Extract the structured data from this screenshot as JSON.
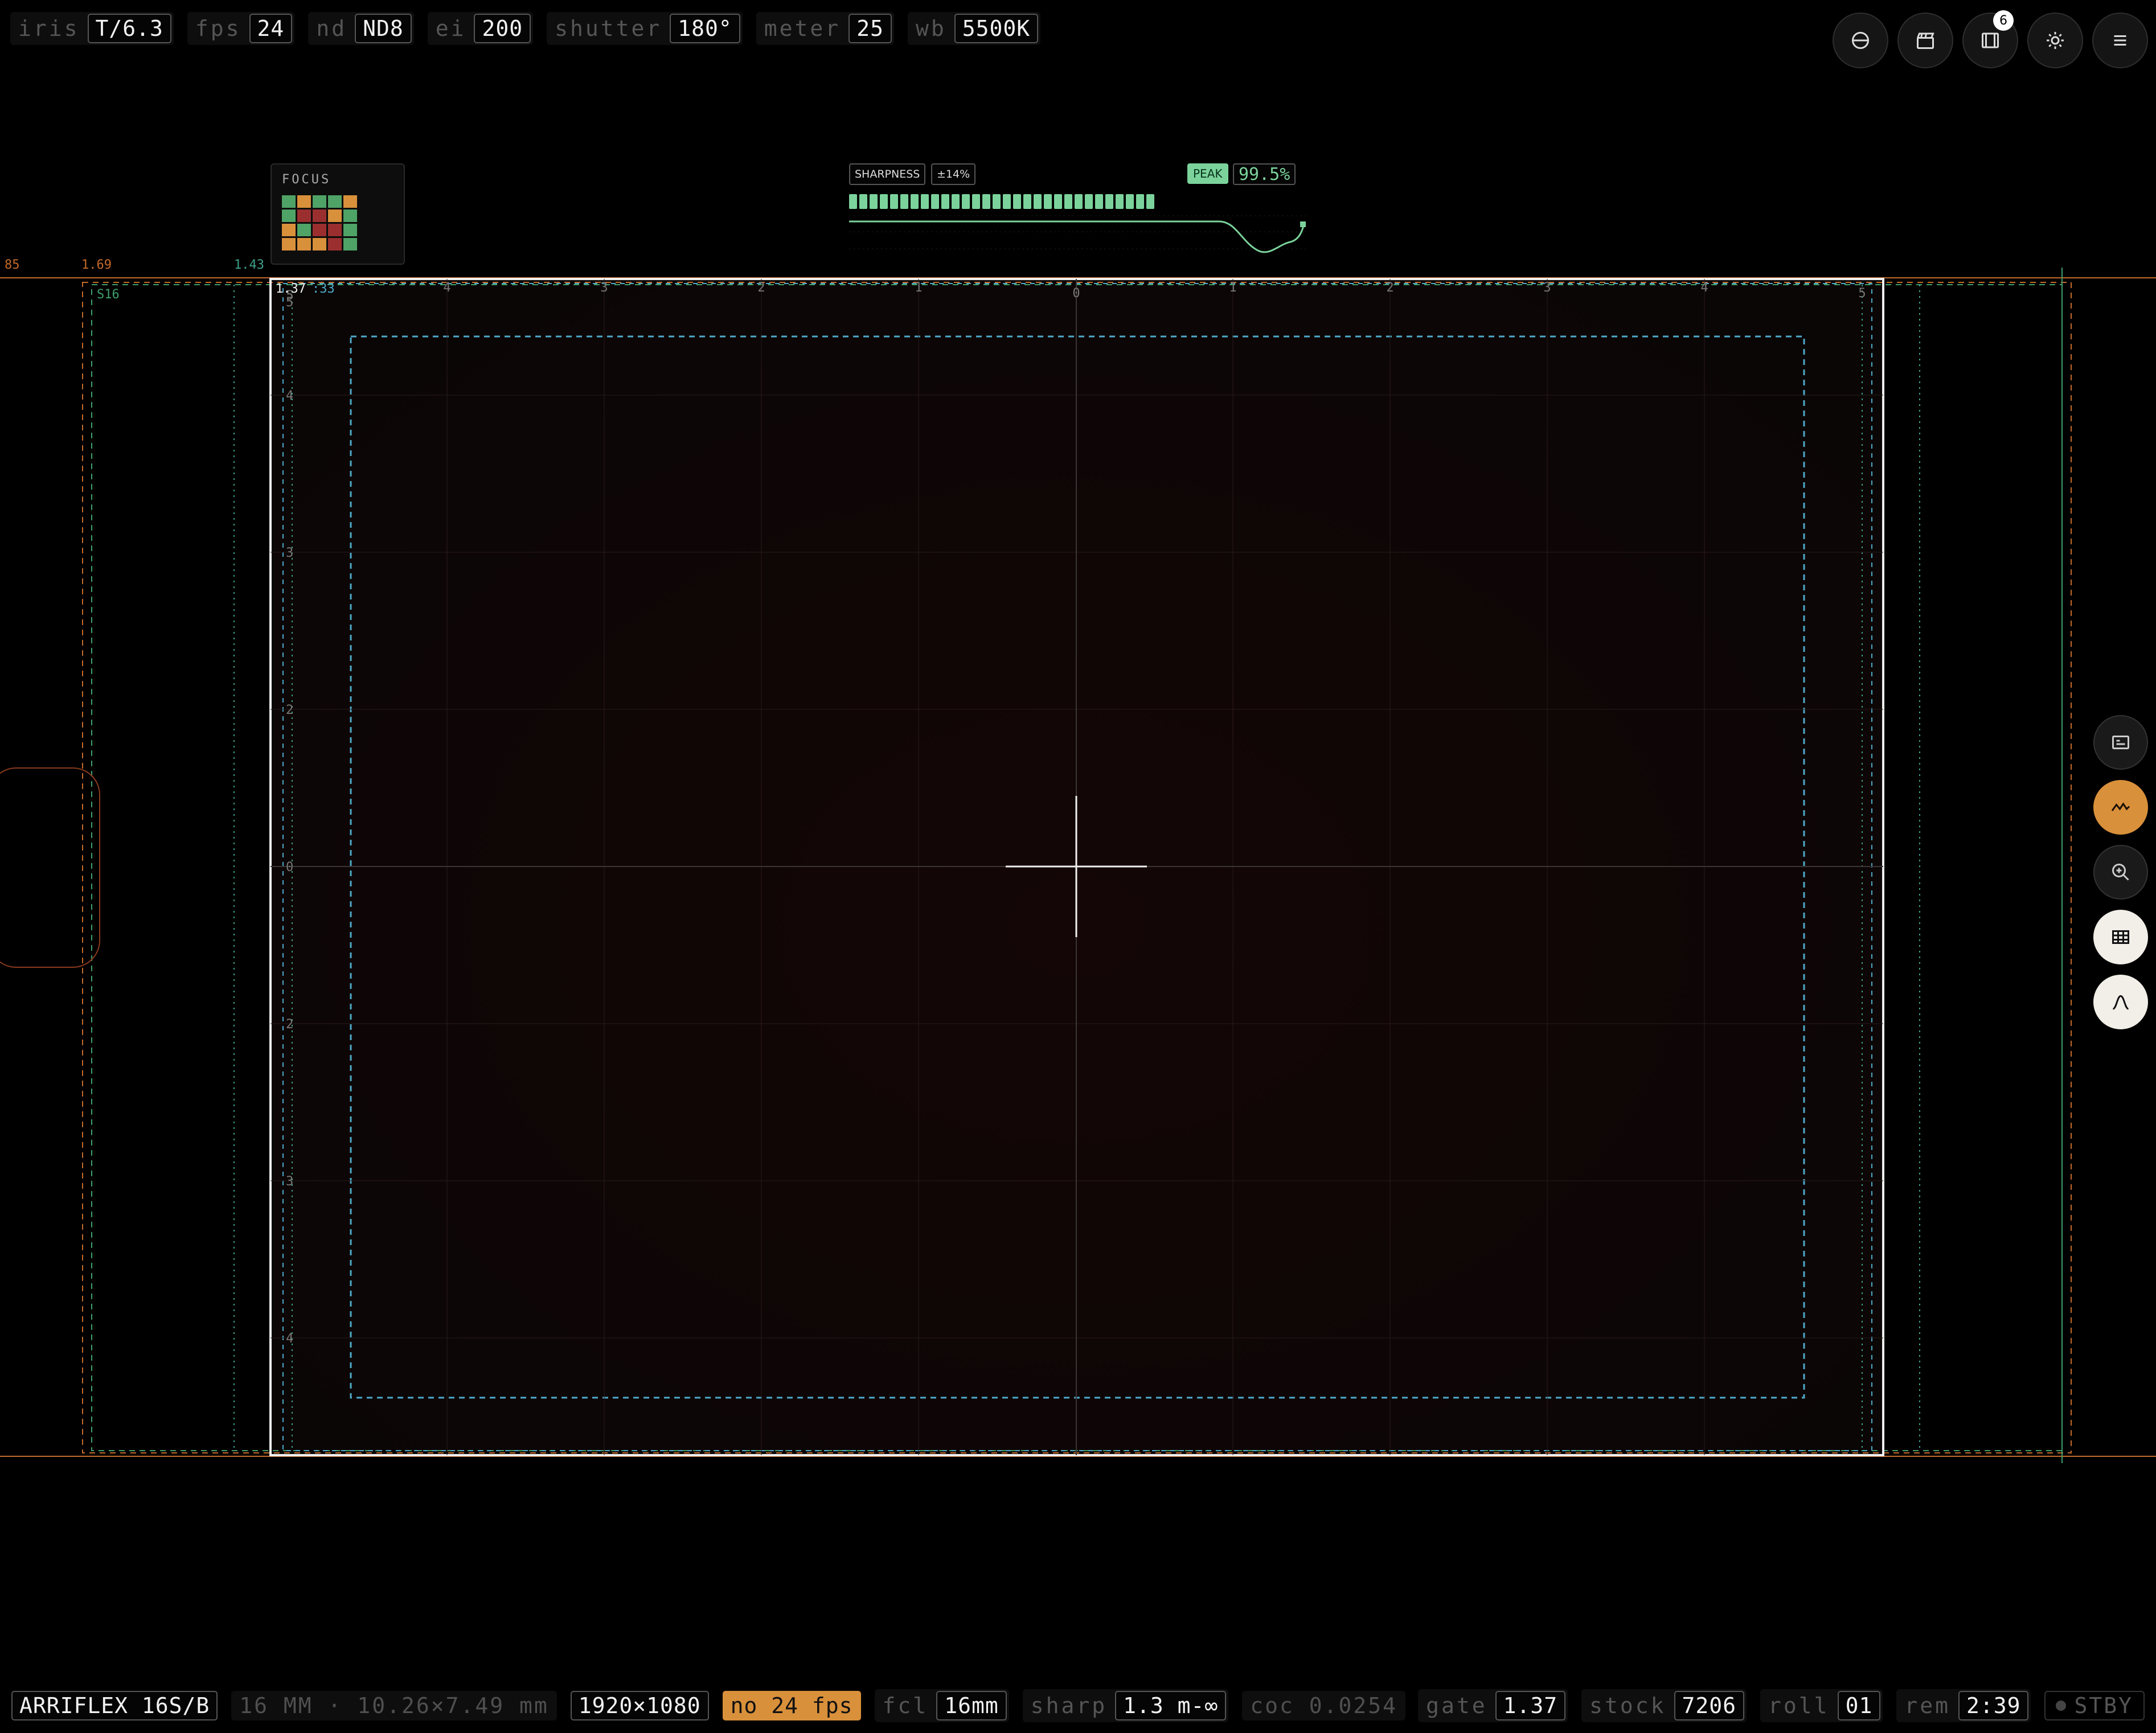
{
  "top_params": [
    {
      "label": "iris",
      "value": "T/6.3"
    },
    {
      "label": "fps",
      "value": "24"
    },
    {
      "label": "nd",
      "value": "ND8"
    },
    {
      "label": "ei",
      "value": "200"
    },
    {
      "label": "shutter",
      "value": "180°"
    },
    {
      "label": "meter",
      "value": "25"
    },
    {
      "label": "wb",
      "value": "5500K"
    }
  ],
  "top_buttons": {
    "notification_count": "6",
    "icons": [
      "aperture-icon",
      "clapper-icon",
      "film-icon",
      "brightness-icon",
      "menu-icon"
    ]
  },
  "side_buttons": {
    "icons": [
      "frame-guide-icon",
      "waveform-icon",
      "zoom-icon",
      "grid-icon",
      "peaking-icon"
    ],
    "active": "waveform-icon"
  },
  "focus_widget": {
    "title": "FOCUS",
    "cells": [
      "#4fa366",
      "#d9903b",
      "#4fa366",
      "#4fa366",
      "#d9903b",
      "#4fa366",
      "#9b2f2f",
      "#9b2f2f",
      "#d9903b",
      "#4fa366",
      "#d9903b",
      "#4fa366",
      "#9b2f2f",
      "#9b2f2f",
      "#4fa366",
      "#d9903b",
      "#d9903b",
      "#d9903b",
      "#9b2f2f",
      "#4fa366"
    ]
  },
  "sharpness": {
    "label": "SHARPNESS",
    "range": "±14%",
    "peak_label": "PEAK",
    "peak_value": "99.5%",
    "bar_count": 30
  },
  "frame_labels": {
    "left_ratios": [
      "85",
      "1.69",
      "1.43"
    ],
    "s16_label": "S16",
    "ratio_tag": "1.37",
    "ratio_tag2": ":33",
    "ruler_top": [
      "5",
      "4",
      "3",
      "2",
      "1",
      "0",
      "1",
      "2",
      "3",
      "4",
      "5"
    ],
    "ruler_left": [
      "5",
      "4",
      "3",
      "2",
      "1",
      "0",
      "1",
      "2",
      "3",
      "4",
      "5"
    ]
  },
  "bottom_left": {
    "camera": "ARRIFLEX 16S/B",
    "format": "16 MM · 10.26×7.49 mm",
    "resolution": "1920×1080",
    "warning": "no 24 fps",
    "fcl_label": "fcl",
    "fcl_value": "16mm",
    "sharp_label": "sharp",
    "sharp_value": "1.3 m-∞",
    "coc": "coc 0.0254"
  },
  "bottom_right": [
    {
      "label": "gate",
      "value": "1.37"
    },
    {
      "label": "stock",
      "value": "7206"
    },
    {
      "label": "roll",
      "value": "01"
    },
    {
      "label": "rem",
      "value": "2:39"
    }
  ],
  "status": "STBY",
  "colors": {
    "accent_orange": "#d9903b",
    "green": "#7bd39b",
    "teal_guide": "#4ea9c9",
    "frame_white": "#f0f0f0",
    "orange_line": "#c46a2a"
  }
}
